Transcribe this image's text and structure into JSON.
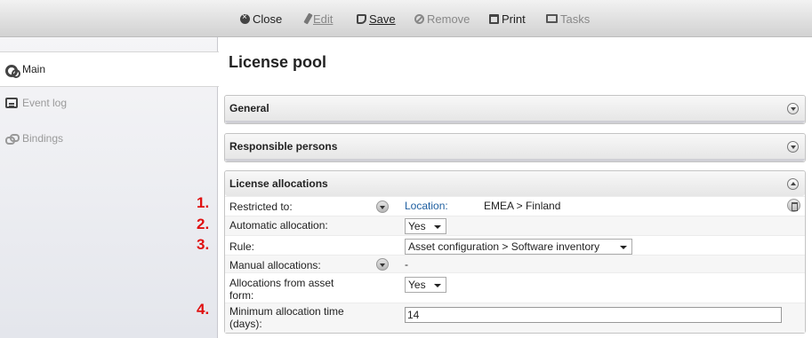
{
  "toolbar": {
    "close": "Close",
    "edit": "Edit",
    "save": "Save",
    "remove": "Remove",
    "print": "Print",
    "tasks": "Tasks"
  },
  "sidebar": {
    "items": [
      {
        "label": "Main",
        "icon": "gears-icon",
        "active": true
      },
      {
        "label": "Event log",
        "icon": "event-log-icon",
        "active": false
      },
      {
        "label": "Bindings",
        "icon": "bindings-icon",
        "active": false
      }
    ]
  },
  "main": {
    "title": "License pool",
    "panels": {
      "general": "General",
      "responsible": "Responsible persons",
      "allocations": "License allocations"
    },
    "rows": {
      "restricted_label": "Restricted to:",
      "location_label": "Location:",
      "location_value": "EMEA > Finland",
      "auto_label": "Automatic allocation:",
      "auto_value": "Yes",
      "rule_label": "Rule:",
      "rule_value": "Asset configuration > Software inventory",
      "manual_label": "Manual allocations:",
      "manual_value": "-",
      "asset_form_label_1": "Allocations from asset",
      "asset_form_label_2": "form:",
      "asset_form_value": "Yes",
      "min_time_label_1": "Minimum allocation time",
      "min_time_label_2": "(days):",
      "min_time_value": "14"
    }
  },
  "markers": [
    "1.",
    "2.",
    "3.",
    "4."
  ],
  "colors": {
    "marker": "#e01010",
    "link": "#1f5fa0"
  }
}
